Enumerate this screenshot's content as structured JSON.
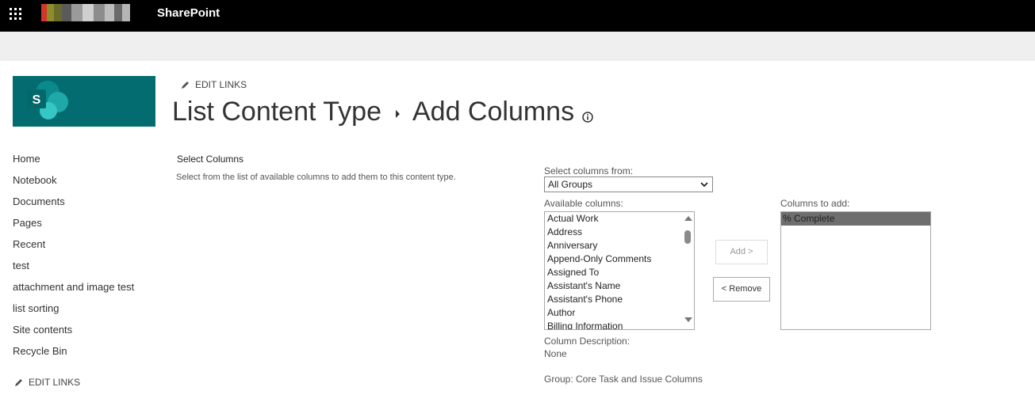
{
  "suitebar": {
    "app_title": "SharePoint",
    "waffle_icon": "app-launcher-icon"
  },
  "edit_links_label": "EDIT LINKS",
  "page": {
    "title_part1": "List Content Type",
    "title_part2": "Add Columns"
  },
  "leftnav": {
    "items": [
      "Home",
      "Notebook",
      "Documents",
      "Pages",
      "Recent",
      "test",
      "attachment and image test",
      "list sorting",
      "Site contents",
      "Recycle Bin"
    ]
  },
  "section": {
    "title": "Select Columns",
    "description": "Select from the list of available columns to add them to this content type."
  },
  "form": {
    "select_from_label": "Select columns from:",
    "select_from_value": "All Groups",
    "available_label": "Available columns:",
    "available_columns": [
      "Actual Work",
      "Address",
      "Anniversary",
      "Append-Only Comments",
      "Assigned To",
      "Assistant's Name",
      "Assistant's Phone",
      "Author",
      "Billing Information"
    ],
    "add_button": "Add >",
    "remove_button": "< Remove",
    "columns_to_add_label": "Columns to add:",
    "columns_to_add": [
      "% Complete"
    ],
    "column_description_label": "Column Description:",
    "column_description_value": "None",
    "group_text": "Group: Core Task and Issue Columns"
  },
  "colors": {
    "suitebar_bg": "#000000",
    "band_bg": "#efefef",
    "site_logo_bg": "#036c70",
    "selected_item_bg": "#6e6e6e"
  }
}
